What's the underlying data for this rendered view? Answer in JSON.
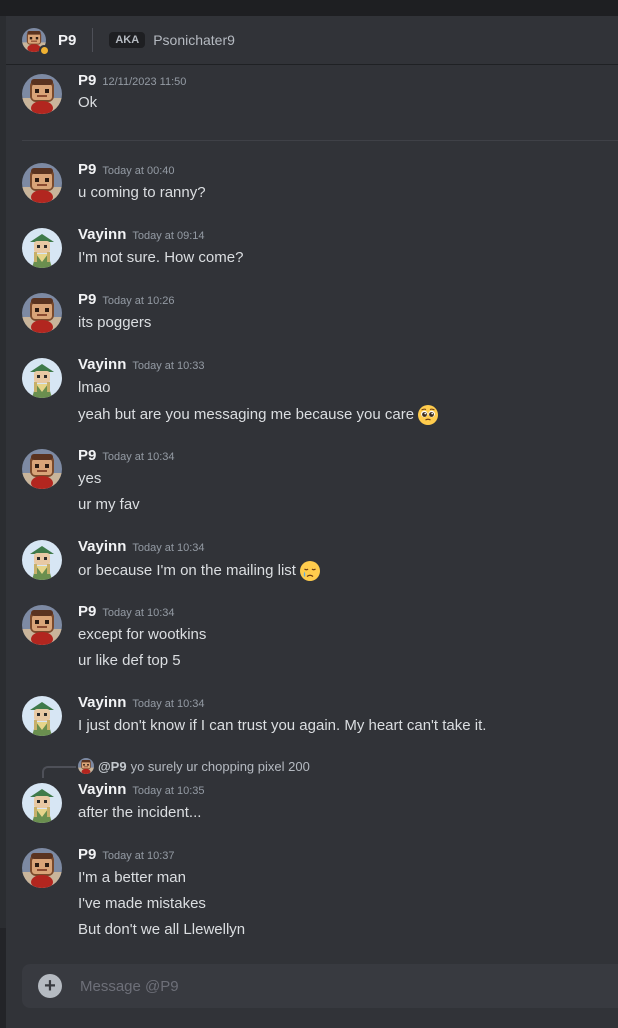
{
  "header": {
    "name": "P9",
    "aka_label": "AKA",
    "aka_name": "Psonichater9"
  },
  "divider_timestamp": "",
  "messages": [
    {
      "author": "P9",
      "time": "12/11/2023 11:50",
      "lines": [
        "Ok"
      ],
      "avatar": "p9"
    },
    {
      "author": "P9",
      "time": "Today at 00:40",
      "lines": [
        "u coming to ranny?"
      ],
      "avatar": "p9"
    },
    {
      "author": "Vayinn",
      "time": "Today at 09:14",
      "lines": [
        "I'm not sure. How come?"
      ],
      "avatar": "vayinn"
    },
    {
      "author": "P9",
      "time": "Today at 10:26",
      "lines": [
        "its poggers"
      ],
      "avatar": "p9"
    },
    {
      "author": "Vayinn",
      "time": "Today at 10:33",
      "lines": [
        "lmao",
        "yeah but are you messaging me because you care"
      ],
      "avatar": "vayinn",
      "emoji_line": 1,
      "emoji": "pleading-face-icon"
    },
    {
      "author": "P9",
      "time": "Today at 10:34",
      "lines": [
        "yes",
        "ur my fav"
      ],
      "avatar": "p9"
    },
    {
      "author": "Vayinn",
      "time": "Today at 10:34",
      "lines": [
        "or because I'm on the mailing list"
      ],
      "avatar": "vayinn",
      "emoji_line": 0,
      "emoji": "crying-face-icon"
    },
    {
      "author": "P9",
      "time": "Today at 10:34",
      "lines": [
        "except for wootkins",
        "ur like def top 5"
      ],
      "avatar": "p9"
    },
    {
      "author": "Vayinn",
      "time": "Today at 10:34",
      "lines": [
        "I just don't know if I can trust you again. My heart can't take it."
      ],
      "avatar": "vayinn"
    },
    {
      "author": "Vayinn",
      "time": "Today at 10:35",
      "lines": [
        "after the incident..."
      ],
      "avatar": "vayinn",
      "reply": {
        "name": "@P9",
        "text": "yo surely ur chopping pixel 200"
      }
    },
    {
      "author": "P9",
      "time": "Today at 10:37",
      "lines": [
        "I'm a better man",
        "I've made mistakes",
        "But don't we all Llewellyn"
      ],
      "avatar": "p9"
    }
  ],
  "composer": {
    "placeholder": "Message @P9",
    "add_icon": "plus-icon"
  },
  "colors": {
    "background": "#313338",
    "text": "#dbdee1",
    "username": "#f2f3f5",
    "timestamp": "#949ba4",
    "status_idle": "#f0b232"
  }
}
